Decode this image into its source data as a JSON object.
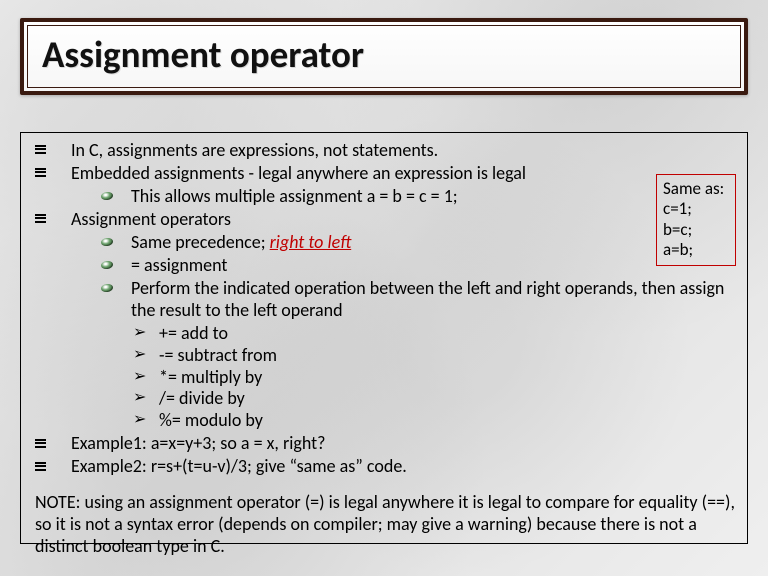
{
  "title": "Assignment operator",
  "bullets_lvl1": {
    "b0": "In C, assignments are expressions, not statements.",
    "b1": "Embedded assignments - legal anywhere an expression is legal",
    "b2": "Assignment operators",
    "b3": "Example1: a=x=y+3; so a = x, right?",
    "b4": "Example2: r=s+(t=u-v)/3; give “same as” code."
  },
  "bullets_lvl2": {
    "s0": "This allows multiple assignment a = b = c = 1;",
    "s1_pre": "Same precedence; ",
    "s1_em": "right to left",
    "s2": "= assignment",
    "s3": "Perform the indicated operation between the left and right operands, then assign the result to the left operand"
  },
  "bullets_lvl3": {
    "o0": "+= add to",
    "o1": "-= subtract from",
    "o2": "*= multiply by",
    "o3": "/= divide by",
    "o4": "%= modulo by"
  },
  "note": "NOTE: using an assignment operator (=) is legal anywhere it is legal to compare for equality (==), so it is not a syntax error (depends on compiler; may give a warning) because there is not a distinct boolean type in C.",
  "sidebox": {
    "l0": "Same as:",
    "l1": "c=1;",
    "l2": "b=c;",
    "l3": "a=b;"
  },
  "arrow": "➢"
}
